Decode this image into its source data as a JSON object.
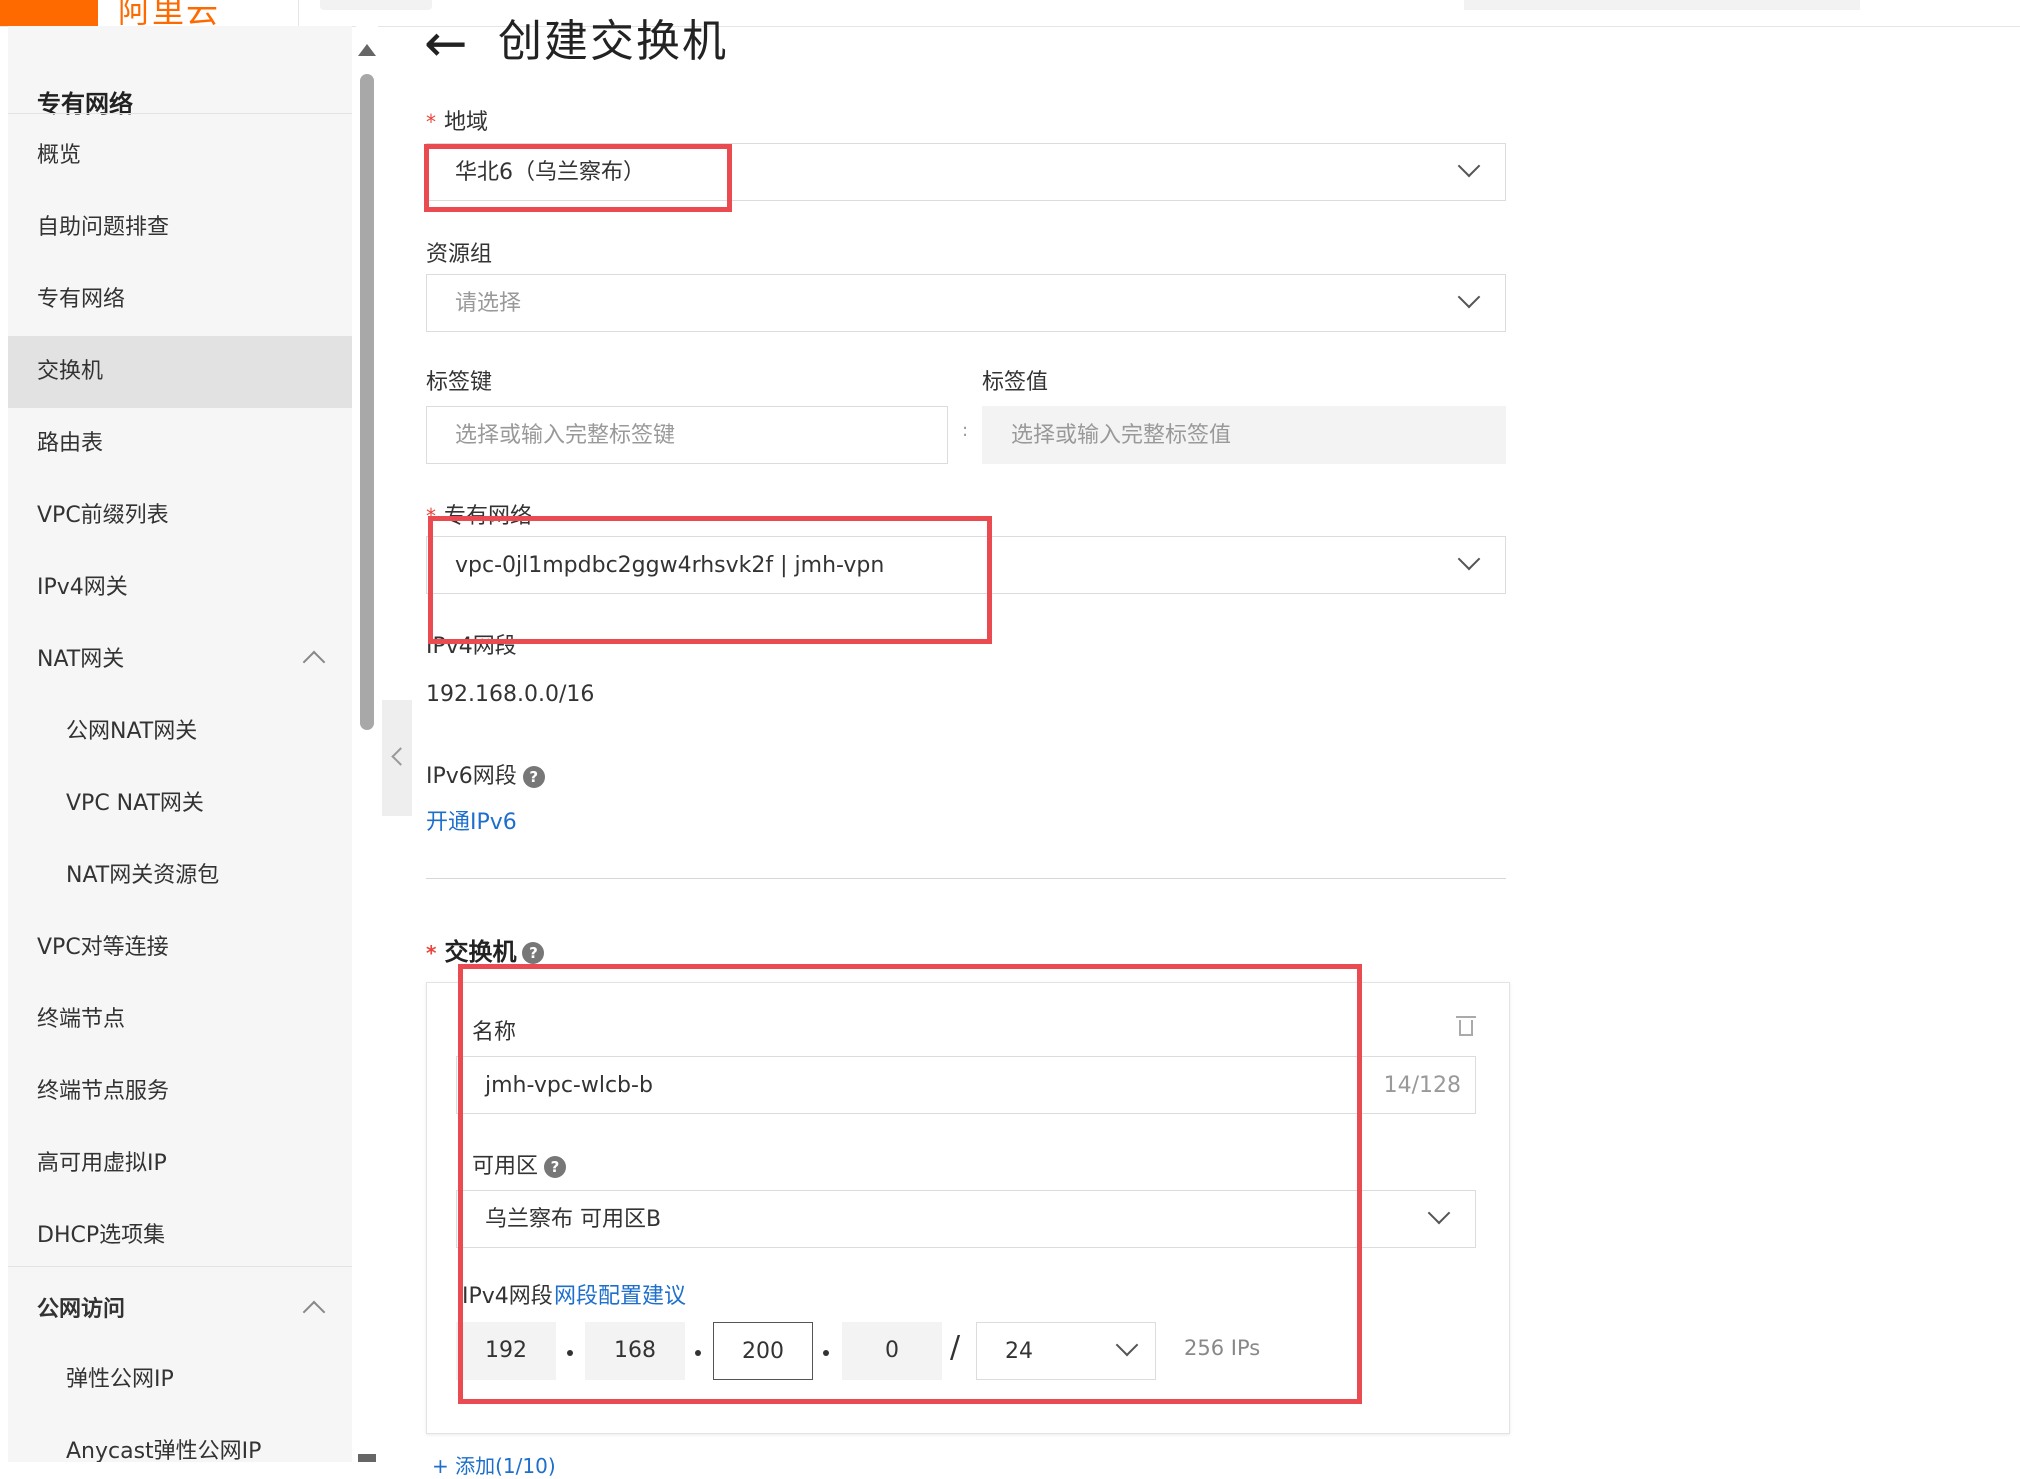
{
  "topbar": {
    "logo": "阿里云"
  },
  "sidebar": {
    "title": "专有网络",
    "items": [
      {
        "label": "概览"
      },
      {
        "label": "自助问题排查"
      },
      {
        "label": "专有网络"
      },
      {
        "label": "交换机"
      },
      {
        "label": "路由表"
      },
      {
        "label": "VPC前缀列表"
      },
      {
        "label": "IPv4网关"
      },
      {
        "label": "NAT网关"
      },
      {
        "label": "公网NAT网关"
      },
      {
        "label": "VPC NAT网关"
      },
      {
        "label": "NAT网关资源包"
      },
      {
        "label": "VPC对等连接"
      },
      {
        "label": "终端节点"
      },
      {
        "label": "终端节点服务"
      },
      {
        "label": "高可用虚拟IP"
      },
      {
        "label": "DHCP选项集"
      },
      {
        "label": "公网访问"
      },
      {
        "label": "弹性公网IP"
      },
      {
        "label": "Anycast弹性公网IP"
      }
    ]
  },
  "page": {
    "title": "创建交换机",
    "back_icon": "←",
    "required_mark": "*",
    "region": {
      "label": "地域",
      "value": "华北6（乌兰察布）"
    },
    "resource_group": {
      "label": "资源组",
      "placeholder": "请选择"
    },
    "tag_key": {
      "label": "标签键",
      "placeholder": "选择或输入完整标签键"
    },
    "tag_sep": ":",
    "tag_value": {
      "label": "标签值",
      "placeholder": "选择或输入完整标签值"
    },
    "vpc": {
      "label": "专有网络",
      "value": "vpc-0jl1mpdbc2ggw4rhsvk2f | jmh-vpn"
    },
    "ipv4_cidr": {
      "label": "IPv4网段",
      "value": "192.168.0.0/16"
    },
    "ipv6_cidr": {
      "label": "IPv6网段",
      "link": "开通IPv6"
    },
    "help_glyph": "?",
    "vswitch": {
      "section_label": "交换机",
      "name_label": "名称",
      "name_value": "jmh-vpc-wlcb-b",
      "name_count": "14/128",
      "zone_label": "可用区",
      "zone_value": "乌兰察布 可用区B",
      "ipv4_label": "IPv4网段",
      "ipv4_link": "网段配置建议",
      "octets": [
        "192",
        "168",
        "200",
        "0"
      ],
      "slash": "/",
      "mask": "24",
      "ip_count": "256 IPs"
    },
    "add_link": "+ 添加(1/10)"
  },
  "colors": {
    "accent": "#ff6a00",
    "highlight": "#ea4b50",
    "link": "#1e6fcc"
  }
}
